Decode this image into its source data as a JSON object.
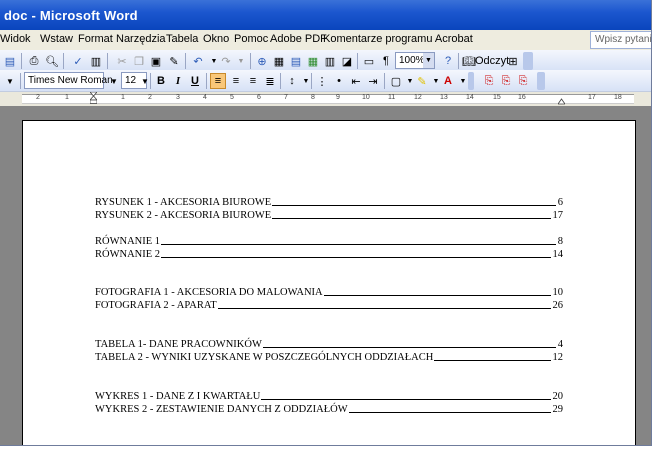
{
  "window": {
    "title": "doc - Microsoft Word"
  },
  "menu": {
    "items": [
      "Widok",
      "Wstaw",
      "Format",
      "Narzędzia",
      "Tabela",
      "Okno",
      "Pomoc",
      "Adobe PDF",
      "Komentarze programu Acrobat"
    ],
    "help_placeholder": "Wpisz pytanie"
  },
  "toolbar": {
    "zoom": "100%",
    "read_label": "Odczyt",
    "font_name": "Times New Roman",
    "font_size": "12",
    "bold": "B",
    "italic": "I",
    "underline": "U"
  },
  "ruler": {
    "ticks": [
      "2",
      "1",
      "1",
      "2",
      "3",
      "4",
      "5",
      "6",
      "7",
      "8",
      "9",
      "10",
      "11",
      "12",
      "13",
      "14",
      "15",
      "16",
      "17",
      "18"
    ]
  },
  "document": {
    "entries": [
      {
        "label": "RYSUNEK 1 - AKCESORIA BIUROWE",
        "page": "6"
      },
      {
        "label": "RYSUNEK 2 - AKCESORIA BIUROWE",
        "page": "17"
      },
      {
        "label": "RÓWNANIE 1",
        "page": "8"
      },
      {
        "label": "RÓWNANIE 2",
        "page": "14"
      },
      {
        "label": "FOTOGRAFIA 1 - AKCESORIA DO MALOWANIA",
        "page": "10"
      },
      {
        "label": "FOTOGRAFIA 2 - APARAT",
        "page": "26"
      },
      {
        "label": "TABELA 1- DANE PRACOWNIKÓW",
        "page": "4"
      },
      {
        "label": "TABELA 2 - WYNIKI UZYSKANE W POSZCZEGÓLNYCH ODDZIAŁACH",
        "page": "12"
      },
      {
        "label": "WYKRES 1 - DANE Z I KWARTAŁU",
        "page": "20"
      },
      {
        "label": "WYKRES 2 - ZESTAWIENIE DANYCH Z ODDZIAŁÓW",
        "page": "29"
      }
    ]
  },
  "colors": {
    "title_bar": "#0a45bd",
    "selected_button": "#f9c779",
    "document_background": "#858585"
  },
  "icons": [
    "save-icon",
    "print-icon",
    "print-preview-icon",
    "spelling-icon",
    "research-icon",
    "cut-icon",
    "copy-icon",
    "paste-icon",
    "format-painter-icon",
    "undo-icon",
    "redo-icon",
    "hyperlink-icon",
    "tables-borders-icon",
    "insert-table-icon",
    "insert-excel-icon",
    "columns-icon",
    "drawing-icon",
    "show-formatting-icon",
    "help-icon"
  ]
}
